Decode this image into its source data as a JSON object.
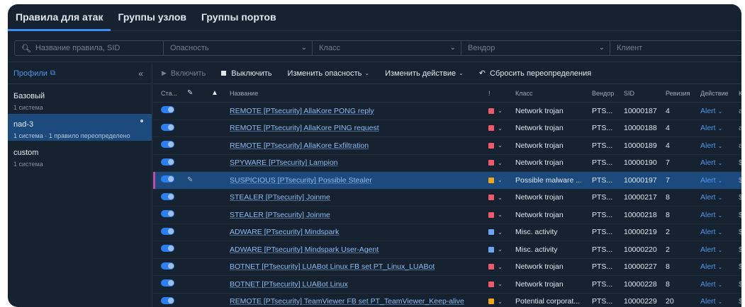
{
  "tabs": [
    {
      "label": "Правила для атак",
      "active": true
    },
    {
      "label": "Группы узлов",
      "active": false
    },
    {
      "label": "Группы портов",
      "active": false
    }
  ],
  "filters": {
    "search_placeholder": "Название правила, SID",
    "severity_placeholder": "Опасность",
    "class_placeholder": "Класс",
    "vendor_placeholder": "Вендор",
    "client_placeholder": "Клиент"
  },
  "sidebar": {
    "title": "Профили",
    "profiles": [
      {
        "name": "Базовый",
        "sub": "1 система",
        "selected": false
      },
      {
        "name": "nad-3",
        "sub": "1 система · 1 правило переопределено",
        "selected": true
      },
      {
        "name": "custom",
        "sub": "1 система",
        "selected": false
      }
    ]
  },
  "toolbar": {
    "enable": "Включить",
    "disable": "Выключить",
    "change_severity": "Изменить опасность",
    "change_action": "Изменить действие",
    "reset": "Сбросить переопределения"
  },
  "columns": {
    "status": "Ста...",
    "name": "Название",
    "severity": "!",
    "class": "Класс",
    "vendor": "Вендор",
    "sid": "SID",
    "revision": "Ревизия",
    "action": "Действие",
    "extra": "К"
  },
  "colors": {
    "accent": "#3d8df5",
    "sev_red": "#ef5a6a",
    "sev_orange": "#f0a61c",
    "sev_blue": "#6aa6f5",
    "highlight_row": "#1d4a7d",
    "highlight_marker": "#c24aa8"
  },
  "rows": [
    {
      "name": "REMOTE [PTsecurity] AllaKore PONG reply",
      "sev": "red",
      "class": "Network trojan",
      "vendor": "PTS...",
      "sid": "10000187",
      "rev": "4",
      "action": "Alert",
      "extra": "a",
      "edited": false
    },
    {
      "name": "REMOTE [PTsecurity] AllaKore PING request",
      "sev": "red",
      "class": "Network trojan",
      "vendor": "PTS...",
      "sid": "10000188",
      "rev": "4",
      "action": "Alert",
      "extra": "a",
      "edited": false
    },
    {
      "name": "REMOTE [PTsecurity] AllaKore Exfiltration",
      "sev": "red",
      "class": "Network trojan",
      "vendor": "PTS...",
      "sid": "10000189",
      "rev": "4",
      "action": "Alert",
      "extra": "a",
      "edited": false
    },
    {
      "name": "SPYWARE [PTsecurity] Lampion",
      "sev": "red",
      "class": "Network trojan",
      "vendor": "PTS...",
      "sid": "10000190",
      "rev": "7",
      "action": "Alert",
      "extra": "$",
      "edited": false
    },
    {
      "name": "SUSPICIOUS [PTsecurity] Possible Stealer",
      "sev": "orange",
      "class": "Possible malware ...",
      "vendor": "PTS...",
      "sid": "10000197",
      "rev": "7",
      "action": "Alert",
      "extra": "$",
      "edited": true
    },
    {
      "name": "STEALER [PTsecurity] Joinme",
      "sev": "red",
      "class": "Network trojan",
      "vendor": "PTS...",
      "sid": "10000217",
      "rev": "8",
      "action": "Alert",
      "extra": "$",
      "edited": false
    },
    {
      "name": "STEALER [PTsecurity] Joinme",
      "sev": "red",
      "class": "Network trojan",
      "vendor": "PTS...",
      "sid": "10000218",
      "rev": "8",
      "action": "Alert",
      "extra": "$",
      "edited": false
    },
    {
      "name": "ADWARE [PTsecurity] Mindspark",
      "sev": "blue",
      "class": "Misc. activity",
      "vendor": "PTS...",
      "sid": "10000219",
      "rev": "2",
      "action": "Alert",
      "extra": "$",
      "edited": false
    },
    {
      "name": "ADWARE [PTsecurity] Mindspark User-Agent",
      "sev": "blue",
      "class": "Misc. activity",
      "vendor": "PTS...",
      "sid": "10000220",
      "rev": "2",
      "action": "Alert",
      "extra": "$",
      "edited": false
    },
    {
      "name": "BOTNET [PTsecurity] LUABot Linux FB set PT_Linux_LUABot",
      "sev": "red",
      "class": "Network trojan",
      "vendor": "PTS...",
      "sid": "10000227",
      "rev": "8",
      "action": "Alert",
      "extra": "$",
      "edited": false
    },
    {
      "name": "BOTNET [PTsecurity] LUABot Linux",
      "sev": "red",
      "class": "Network trojan",
      "vendor": "PTS...",
      "sid": "10000228",
      "rev": "8",
      "action": "Alert",
      "extra": "$",
      "edited": false
    },
    {
      "name": "REMOTE [PTsecurity] TeamViewer FB set PT_TeamViewer_Keep-alive",
      "sev": "orange",
      "class": "Potential corporat...",
      "vendor": "PTS...",
      "sid": "10000229",
      "rev": "20",
      "action": "Alert",
      "extra": "$",
      "edited": false
    }
  ]
}
